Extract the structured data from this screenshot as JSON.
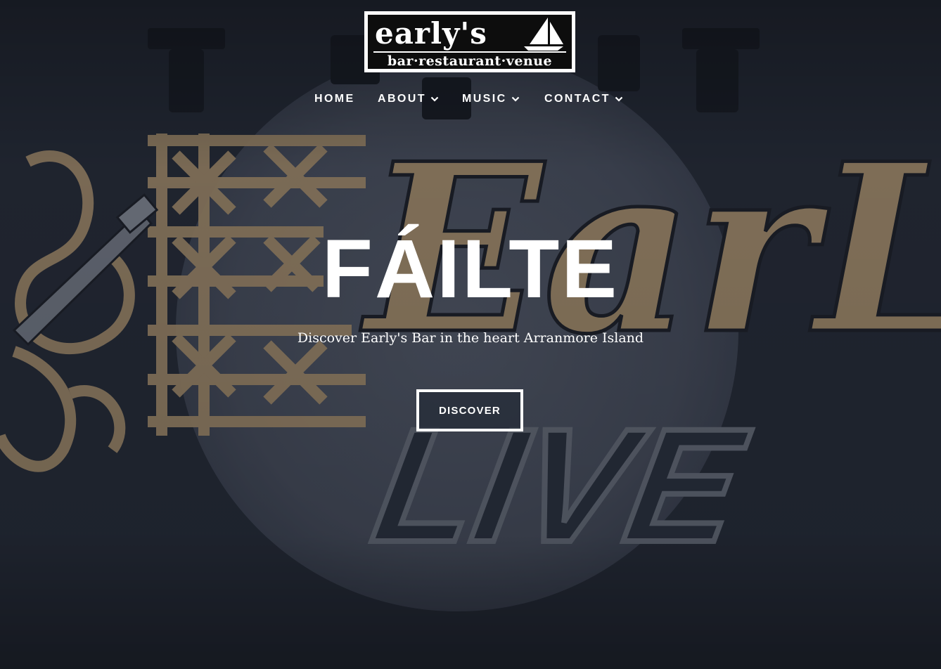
{
  "header": {
    "logo": {
      "name": "early's",
      "tagline": "bar·restaurant·venue"
    },
    "nav": [
      {
        "label": "HOME",
        "has_dropdown": false
      },
      {
        "label": "ABOUT",
        "has_dropdown": true
      },
      {
        "label": "MUSIC",
        "has_dropdown": true
      },
      {
        "label": "CONTACT",
        "has_dropdown": true
      }
    ]
  },
  "hero": {
    "title": "FÁILTE",
    "subtitle": "Discover Early's Bar in the heart Arranmore Island",
    "cta_label": "DISCOVER",
    "background_text": {
      "wall_name": "EarLy's",
      "wall_sign": "LIVE"
    }
  },
  "colors": {
    "text": "#ffffff",
    "backdrop": "#2a2f3a",
    "spotlight": "#5a6070",
    "wall_art": "#c8a87a",
    "button_fill": "#1e2432"
  }
}
